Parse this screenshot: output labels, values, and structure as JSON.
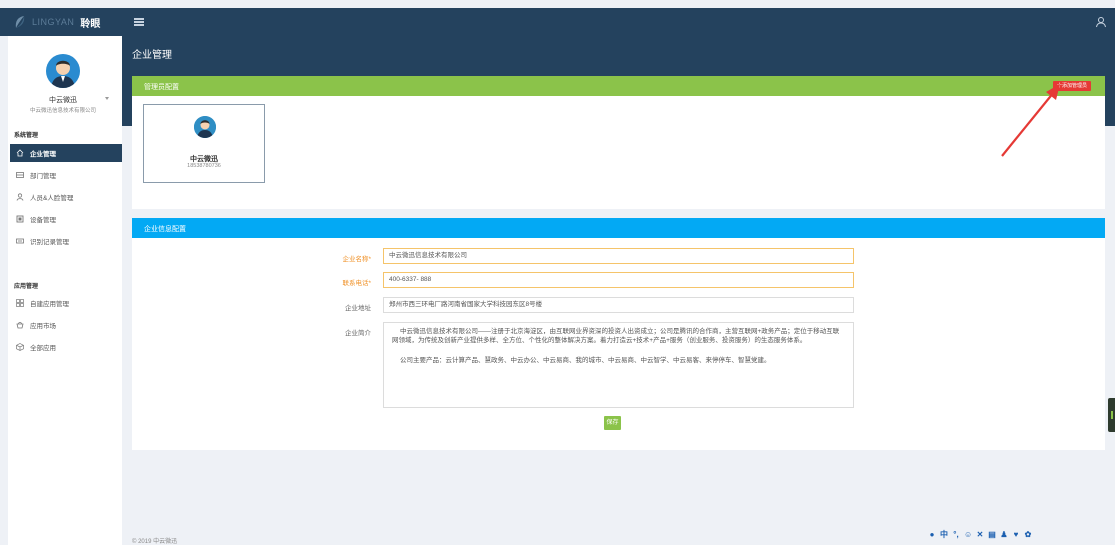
{
  "topbar": {
    "brand_en": "LINGYAN",
    "brand_cn": "聆眼",
    "menu_icon": "hamburger-icon",
    "user_icon": "user-icon"
  },
  "page": {
    "title": "企业管理"
  },
  "sidebar": {
    "profile": {
      "name": "中云微迅",
      "org": "中云微迅信息技术有限公司"
    },
    "groups": [
      {
        "title": "系统管理",
        "items": [
          {
            "label": "企业管理",
            "icon": "home-icon",
            "active": true
          },
          {
            "label": "部门管理",
            "icon": "department-icon"
          },
          {
            "label": "人员&人脸管理",
            "icon": "person-icon"
          },
          {
            "label": "设备管理",
            "icon": "device-icon"
          },
          {
            "label": "识别记录管理",
            "icon": "record-icon"
          }
        ]
      },
      {
        "title": "应用管理",
        "items": [
          {
            "label": "自建应用管理",
            "icon": "grid-icon"
          },
          {
            "label": "应用市场",
            "icon": "market-icon"
          },
          {
            "label": "全部应用",
            "icon": "cube-icon"
          }
        ]
      }
    ]
  },
  "admin_panel": {
    "title": "管理员配置",
    "add_button": "十添加管理员",
    "admin": {
      "name": "中云微迅",
      "phone": "18538780736"
    }
  },
  "info_panel": {
    "title": "企业信息配置",
    "fields": {
      "name": {
        "label": "企业名称*",
        "value": "中云微迅信息技术有限公司"
      },
      "phone": {
        "label": "联系电话*",
        "value": "400-6337- 888"
      },
      "address": {
        "label": "企业地址",
        "value": "郑州市西三环电厂路河南省国家大学科技园东区8号楼"
      },
      "intro": {
        "label": "企业简介",
        "p1": "中云微迅信息技术有限公司——注册于北京海淀区，由互联网业界资深的投资人出资成立；公司是腾讯的合作商，主营互联网+政务产品；定位于移动互联网领域，为传统及创新产业提供多样、全方位、个性化的整体解决方案。着力打造云+技术+产品+服务（创业服务、投资服务）的生态服务体系。",
        "p2": "公司主要产品：云计算产品、慧政务、中云办公、中云易商、我的城市、中云易商、中云智学、中云易客、来停停车、智慧党建。"
      }
    },
    "save_button": "保存"
  },
  "footer": {
    "copyright": "© 2019 中云微迅"
  },
  "colors": {
    "navy": "#24425e",
    "green": "#8bc34a",
    "blue": "#03a9f4",
    "red": "#e53935",
    "required": "#f0932b"
  }
}
